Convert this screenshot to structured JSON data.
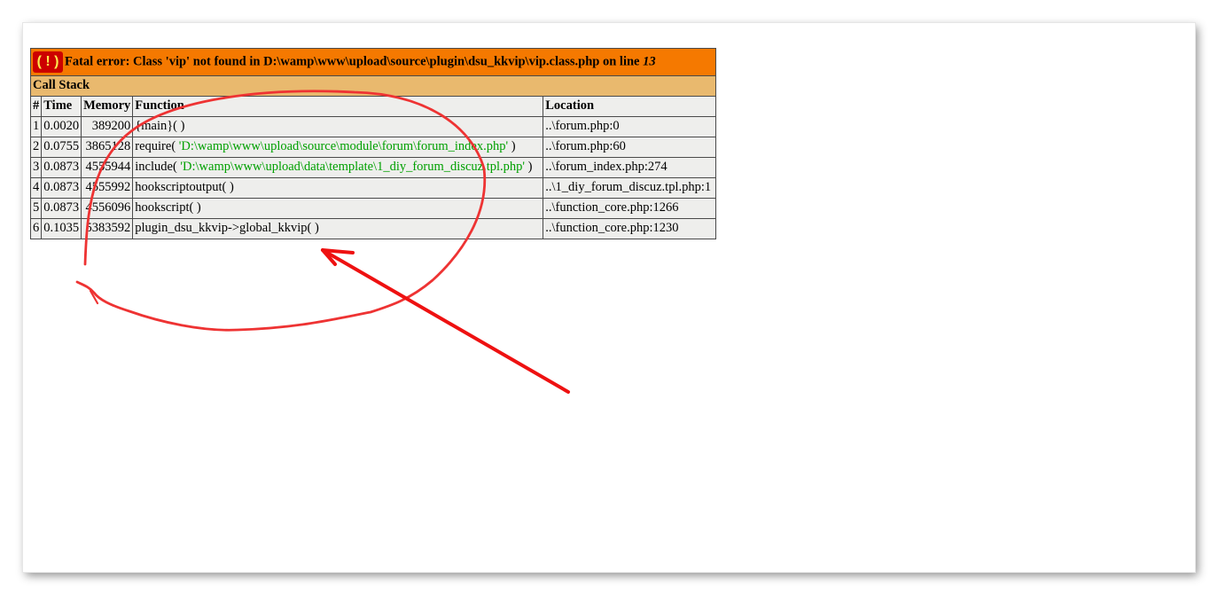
{
  "error": {
    "icon_text": "( ! )",
    "message": "Fatal error: Class 'vip' not found in D:\\wamp\\www\\upload\\source\\plugin\\dsu_kkvip\\vip.class.php on line ",
    "line": "13"
  },
  "call_stack_title": "Call Stack",
  "columns": [
    "#",
    "Time",
    "Memory",
    "Function",
    "Location"
  ],
  "rows": [
    {
      "num": "1",
      "time": "0.0020",
      "memory": "389200",
      "func": "{main}( )",
      "arg": "",
      "func_tail": "",
      "location": "..\\forum.php:0"
    },
    {
      "num": "2",
      "time": "0.0755",
      "memory": "3865128",
      "func": "require( ",
      "arg": "'D:\\wamp\\www\\upload\\source\\module\\forum\\forum_index.php'",
      "func_tail": " )",
      "location": "..\\forum.php:60"
    },
    {
      "num": "3",
      "time": "0.0873",
      "memory": "4555944",
      "func": "include( ",
      "arg": "'D:\\wamp\\www\\upload\\data\\template\\1_diy_forum_discuz.tpl.php'",
      "func_tail": " )",
      "location": "..\\forum_index.php:274"
    },
    {
      "num": "4",
      "time": "0.0873",
      "memory": "4555992",
      "func": "hookscriptoutput( )",
      "arg": "",
      "func_tail": "",
      "location": "..\\1_diy_forum_discuz.tpl.php:1"
    },
    {
      "num": "5",
      "time": "0.0873",
      "memory": "4556096",
      "func": "hookscript( )",
      "arg": "",
      "func_tail": "",
      "location": "..\\function_core.php:1266"
    },
    {
      "num": "6",
      "time": "0.1035",
      "memory": "5383592",
      "func": "plugin_dsu_kkvip->global_kkvip( )",
      "arg": "",
      "func_tail": "",
      "location": "..\\function_core.php:1230"
    }
  ],
  "colors": {
    "error_bg": "#f57900",
    "callstack_bg": "#e9b96e",
    "row_bg": "#eeeeec",
    "icon_bg": "#cc0000",
    "icon_fg": "#fce94f",
    "arg_color": "#00a000",
    "annotation": "#ee3333"
  }
}
